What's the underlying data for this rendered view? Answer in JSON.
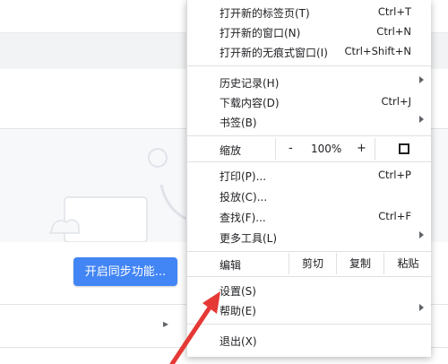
{
  "background": {
    "sync_button_label": "开启同步功能..."
  },
  "menu": {
    "group1": [
      {
        "label": "打开新的标签页(T)",
        "shortcut": "Ctrl+T"
      },
      {
        "label": "打开新的窗口(N)",
        "shortcut": "Ctrl+N"
      },
      {
        "label": "打开新的无痕式窗口(I)",
        "shortcut": "Ctrl+Shift+N"
      }
    ],
    "group2": [
      {
        "label": "历史记录(H)",
        "shortcut": ""
      },
      {
        "label": "下载内容(D)",
        "shortcut": "Ctrl+J"
      },
      {
        "label": "书签(B)",
        "shortcut": ""
      }
    ],
    "zoom": {
      "label": "缩放",
      "minus": "-",
      "value": "100%",
      "plus": "+"
    },
    "group3": [
      {
        "label": "打印(P)...",
        "shortcut": "Ctrl+P"
      },
      {
        "label": "投放(C)...",
        "shortcut": ""
      },
      {
        "label": "查找(F)...",
        "shortcut": "Ctrl+F"
      },
      {
        "label": "更多工具(L)",
        "shortcut": ""
      }
    ],
    "edit": {
      "label": "编辑",
      "cut": "剪切",
      "copy": "复制",
      "paste": "粘贴"
    },
    "group4": [
      {
        "label": "设置(S)",
        "shortcut": ""
      },
      {
        "label": "帮助(E)",
        "shortcut": ""
      }
    ],
    "exit": {
      "label": "退出(X)"
    }
  },
  "colors": {
    "accent": "#4285f4",
    "pointer_arrow": "#e53935"
  }
}
